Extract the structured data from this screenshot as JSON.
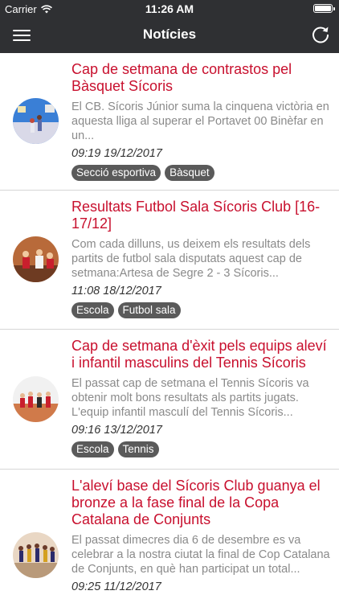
{
  "status_bar": {
    "carrier": "Carrier",
    "time": "11:26 AM"
  },
  "navbar": {
    "title": "Notícies",
    "menu_icon": "hamburger-menu-icon",
    "refresh_icon": "refresh-icon"
  },
  "news": [
    {
      "title": "Cap de setmana de contrastos pel Bàsquet Sícoris",
      "excerpt": "El CB. Sícoris Júnior suma la cinquena victòria en aquesta lliga al superar el Portavet 00 Binèfar en un...",
      "date": "09:19 19/12/2017",
      "tags": [
        "Secció esportiva",
        "Bàsquet"
      ]
    },
    {
      "title": "Resultats Futbol Sala Sícoris Club [16-17/12]",
      "excerpt": "Com cada dilluns, us deixem els resultats dels partits de futbol sala disputats aquest cap de setmana:Artesa de Segre 2 - 3 Sícoris...",
      "date": "11:08 18/12/2017",
      "tags": [
        "Escola",
        "Futbol sala"
      ]
    },
    {
      "title": "Cap de setmana d'èxit pels equips aleví i infantil masculins del Tennis Sícoris",
      "excerpt": "El passat cap de setmana el Tennis Sícoris va obtenir molt bons resultats als partits jugats. L'equip infantil masculí del Tennis Sícoris...",
      "date": "09:16 13/12/2017",
      "tags": [
        "Escola",
        "Tennis"
      ]
    },
    {
      "title": "L'aleví base del Sícoris Club guanya el bronze a la fase final de la Copa Catalana de Conjunts",
      "excerpt": "El passat dimecres dia 6 de desembre es va celebrar a la nostra ciutat la final de Cop Catalana de Conjunts, en què han participat un total...",
      "date": "09:25 11/12/2017",
      "tags": []
    }
  ]
}
